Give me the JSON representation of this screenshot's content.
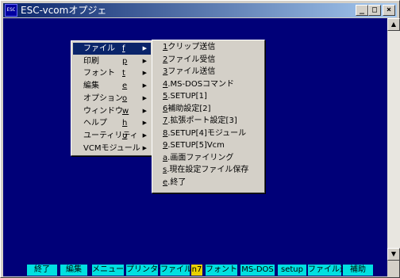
{
  "window": {
    "title": "ESC-vcomオプジェ",
    "app_icon_label": "ESC",
    "buttons": {
      "minimize": "_",
      "maximize": "□",
      "close": "×"
    }
  },
  "scrollbar": {
    "up": "▲",
    "down": "▼"
  },
  "main_menu": [
    {
      "label": "ファイル",
      "key": "f",
      "selected": true
    },
    {
      "label": "印刷",
      "key": "p"
    },
    {
      "label": "フォント",
      "key": "t"
    },
    {
      "label": "編集",
      "key": "e"
    },
    {
      "label": "オプション",
      "key": "o"
    },
    {
      "label": "ウィンドウ",
      "key": "w"
    },
    {
      "label": "ヘルプ",
      "key": "h"
    },
    {
      "label": "ユーティリティ",
      "key": "u"
    },
    {
      "label": "VCMモジュール",
      "key": ""
    }
  ],
  "menu_arrow": "▶",
  "file_submenu": [
    {
      "key": "1",
      "label": "クリップ送信"
    },
    {
      "key": "2",
      "label": "ファイル受信"
    },
    {
      "key": "3",
      "label": "ファイル送信"
    },
    {
      "key": "4",
      "label": ".MS-DOSコマンド"
    },
    {
      "key": "5",
      "label": ".SETUP[1]"
    },
    {
      "key": "6",
      "label": "補助設定[2]"
    },
    {
      "key": "7",
      "label": ".拡張ポート設定[3]"
    },
    {
      "key": "8",
      "label": ".SETUP[4]モジュール"
    },
    {
      "key": "9",
      "label": ".SETUP[5]Vcm"
    },
    {
      "key": "a",
      "label": ".画面ファイリング"
    },
    {
      "key": "s",
      "label": ".現在設定ファイル保存"
    },
    {
      "key": "e",
      "label": ".終了"
    }
  ],
  "function_keys": [
    {
      "label": "終了"
    },
    {
      "label": "編集"
    },
    {
      "label": "メニュー"
    },
    {
      "label": "プリンター"
    },
    {
      "label": "ファイル受"
    },
    {
      "label": "n7",
      "highlight": true
    },
    {
      "label": "フォント"
    },
    {
      "label": "MS-DOS"
    },
    {
      "label": "setup"
    },
    {
      "label": "ファイル送"
    },
    {
      "label": "補助"
    }
  ],
  "colors": {
    "terminal_bg": "#000078",
    "fkey_bg": "#00e0e0",
    "fkey_highlight": "#e8d000",
    "menu_selection": "#0a246a"
  }
}
